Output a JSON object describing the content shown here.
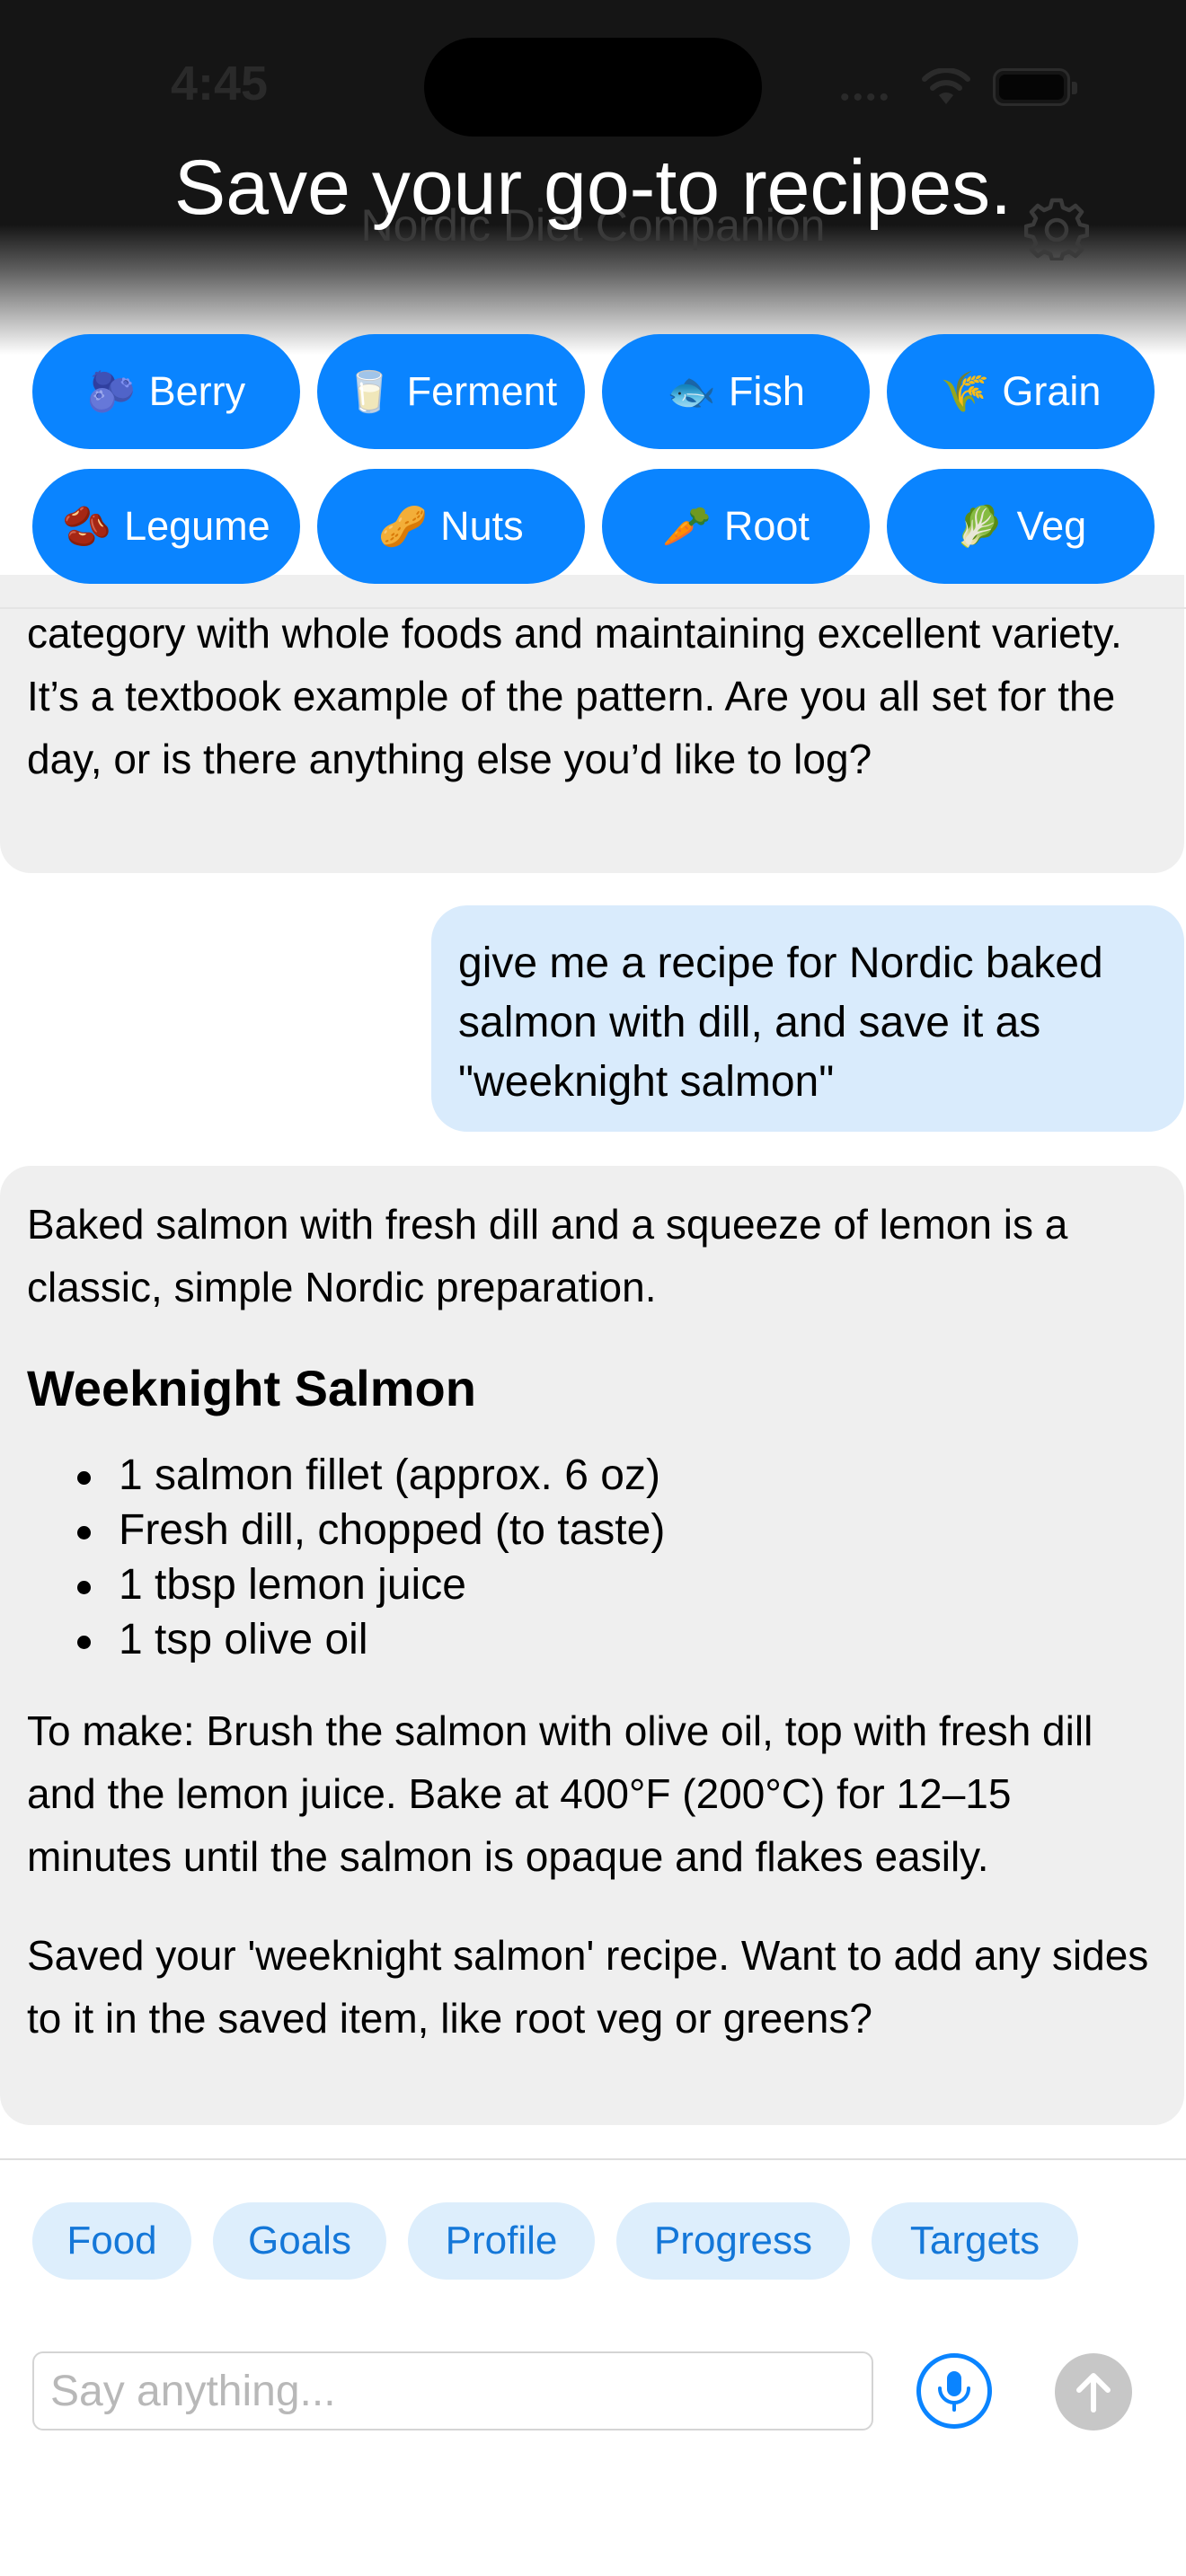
{
  "status_bar": {
    "time": "4:45",
    "dots": "••••"
  },
  "header": {
    "app_title": "Nordic Diet Companion",
    "banner_headline": "Save your go-to recipes."
  },
  "categories": [
    {
      "emoji": "🫐",
      "label": "Berry"
    },
    {
      "emoji": "🥛",
      "label": "Ferment"
    },
    {
      "emoji": "🐟",
      "label": "Fish"
    },
    {
      "emoji": "🌾",
      "label": "Grain"
    },
    {
      "emoji": "🫘",
      "label": "Legume"
    },
    {
      "emoji": "🥜",
      "label": "Nuts"
    },
    {
      "emoji": "🥕",
      "label": "Root"
    },
    {
      "emoji": "🥬",
      "label": "Veg"
    }
  ],
  "chat": {
    "prev_bot_text": "category with whole foods and maintaining excellent variety. It’s a textbook example of the pattern. Are you all set for the day, or is there anything else you’d like to log?",
    "user_message": "give me a recipe for Nordic baked salmon with dill, and save it as \"weeknight salmon\"",
    "bot_reply": {
      "intro": "Baked salmon with fresh dill and a squeeze of lemon is a classic, simple Nordic preparation.",
      "recipe_title": "Weeknight Salmon",
      "ingredients": [
        "1 salmon fillet (approx. 6 oz)",
        "Fresh dill, chopped (to taste)",
        "1 tbsp lemon juice",
        "1 tsp olive oil"
      ],
      "instructions": "To make: Brush the salmon with olive oil, top with fresh dill and the lemon juice. Bake at 400°F (200°C) for 12–15 minutes until the salmon is opaque and flakes easily.",
      "saved_note": "Saved your 'weeknight salmon' recipe. Want to add any sides to it in the saved item, like root veg or greens?"
    }
  },
  "quick_actions": [
    "Food",
    "Goals",
    "Profile",
    "Progress",
    "Targets"
  ],
  "composer": {
    "placeholder": "Say anything...",
    "value": ""
  },
  "colors": {
    "accent": "#0a84ff",
    "header_bg": "#151515",
    "user_bubble": "#d9ebfc",
    "bot_bubble": "#efefef",
    "quick_chip_bg": "#ddeefc",
    "quick_chip_text": "#1477d8"
  },
  "icons": {
    "settings": "gear-icon",
    "mic": "microphone-icon",
    "send": "arrow-up-icon",
    "wifi": "wifi-icon",
    "battery": "battery-icon"
  }
}
